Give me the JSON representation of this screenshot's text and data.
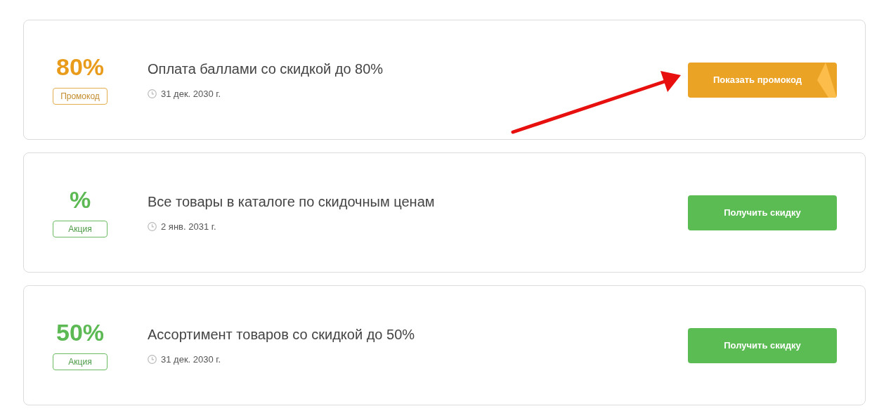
{
  "offers": [
    {
      "kind": "promo",
      "value": "80%",
      "tag": "Промокод",
      "title": "Оплата баллами со скидкой до 80%",
      "date": "31 дек. 2030 г.",
      "button": "Показать промокод"
    },
    {
      "kind": "sale",
      "value": "%",
      "tag": "Акция",
      "title": "Все товары в каталоге по скидочным ценам",
      "date": "2 янв. 2031 г.",
      "button": "Получить скидку"
    },
    {
      "kind": "sale",
      "value": "50%",
      "tag": "Акция",
      "title": "Ассортимент товаров со скидкой до 50%",
      "date": "31 дек. 2030 г.",
      "button": "Получить скидку"
    }
  ]
}
